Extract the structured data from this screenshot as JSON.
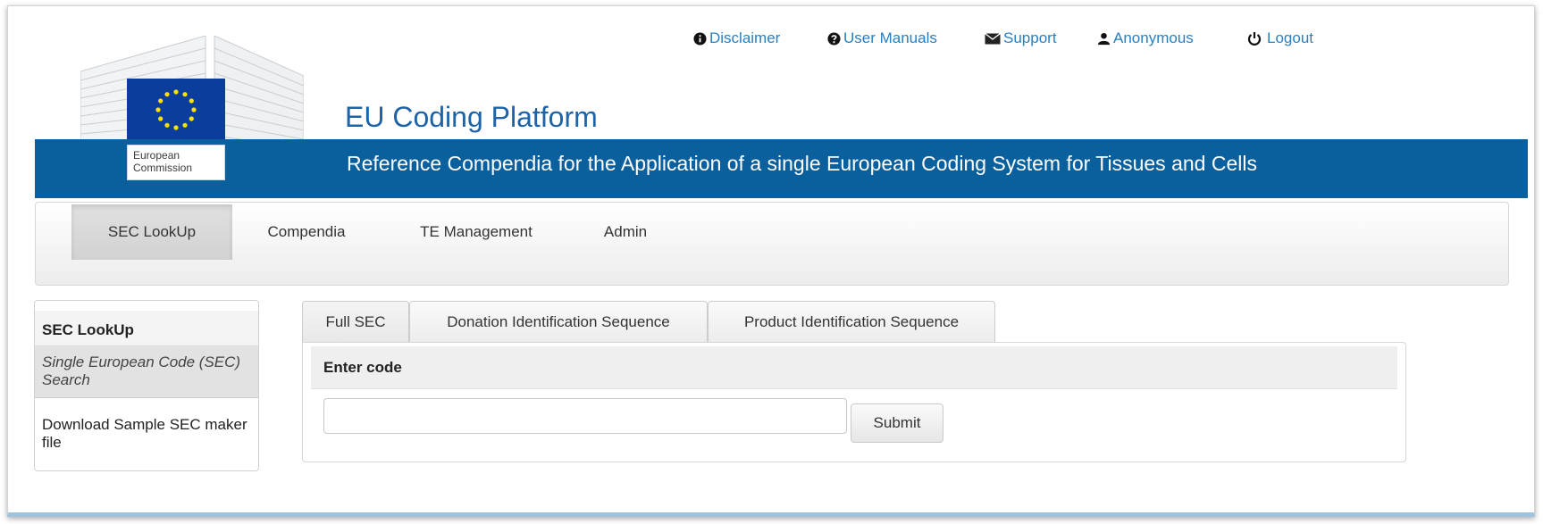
{
  "top_links": [
    {
      "label": "Disclaimer",
      "icon": "info-circle-icon"
    },
    {
      "label": "User Manuals",
      "icon": "question-circle-icon"
    },
    {
      "label": "Support",
      "icon": "envelope-icon"
    },
    {
      "label": "Anonymous",
      "icon": "user-icon"
    },
    {
      "label": "Logout",
      "icon": "power-icon"
    }
  ],
  "header": {
    "title": "EU Coding Platform",
    "subtitle": "Reference Compendia for the Application of a single European Coding System for Tissues and Cells",
    "logo_line1": "European",
    "logo_line2": "Commission"
  },
  "nav": {
    "items": [
      {
        "label": "SEC LookUp",
        "active": true
      },
      {
        "label": "Compendia",
        "active": false
      },
      {
        "label": "TE Management",
        "active": false
      },
      {
        "label": "Admin",
        "active": false
      }
    ]
  },
  "sidebar": {
    "heading": "SEC LookUp",
    "active_item": "Single European Code (SEC) Search",
    "link_item": "Download Sample SEC maker file"
  },
  "tabs": [
    {
      "label": "Full SEC",
      "active": true
    },
    {
      "label": "Donation Identification Sequence",
      "active": false
    },
    {
      "label": "Product Identification Sequence",
      "active": false
    }
  ],
  "form": {
    "heading": "Enter code",
    "input_value": "",
    "submit_label": "Submit"
  },
  "colors": {
    "banner_blue": "#0a5f9d",
    "title_blue": "#1d63a6",
    "link_blue": "#2a7fc1",
    "eu_flag_blue": "#0b3e9c",
    "eu_star_yellow": "#ffe100"
  }
}
